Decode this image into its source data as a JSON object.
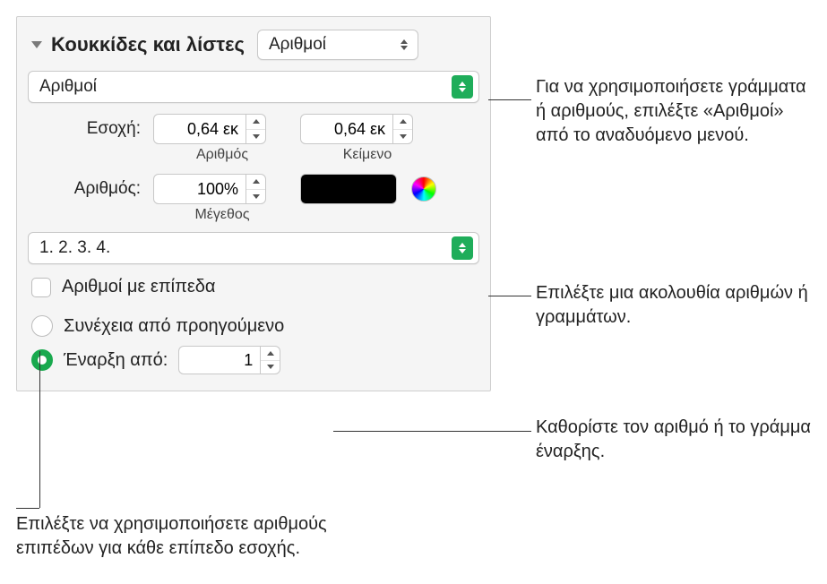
{
  "header": {
    "title": "Κουκκίδες και λίστες",
    "type_select": "Αριθμοί"
  },
  "style_select": "Αριθμοί",
  "indent": {
    "label": "Εσοχή:",
    "number_value": "0,64 εκ",
    "text_value": "0,64 εκ",
    "number_sublabel": "Αριθμός",
    "text_sublabel": "Κείμενο"
  },
  "number": {
    "label": "Αριθμός:",
    "size_value": "100%",
    "size_sublabel": "Μέγεθος"
  },
  "sequence_select": "1. 2. 3. 4.",
  "tiered_label": "Αριθμοί με επίπεδα",
  "continue_label": "Συνέχεια από προηγούμενο",
  "start_from_label": "Έναρξη από:",
  "start_from_value": "1",
  "callouts": {
    "style": "Για να χρησιμοποιήσετε γράμματα ή αριθμούς, επιλέξτε «Αριθμοί» από το αναδυόμενο μενού.",
    "sequence": "Επιλέξτε μια ακολουθία αριθμών ή γραμμάτων.",
    "start": "Καθορίστε τον αριθμό ή το γράμμα έναρξης.",
    "tiered": "Επιλέξτε να χρησιμοποιήσετε αριθμούς επιπέδων για κάθε επίπεδο εσοχής."
  }
}
